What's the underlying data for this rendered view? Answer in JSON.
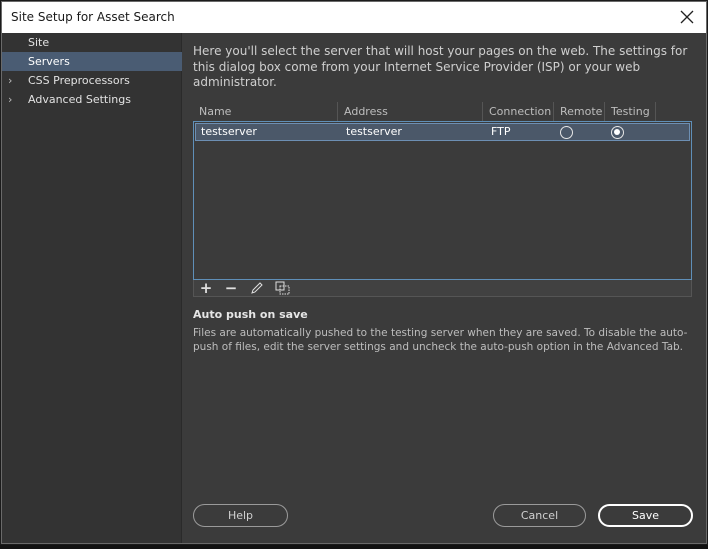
{
  "window": {
    "title": "Site Setup for Asset Search"
  },
  "sidebar": {
    "items": [
      {
        "label": "Site",
        "expandable": false,
        "active": false
      },
      {
        "label": "Servers",
        "expandable": false,
        "active": true
      },
      {
        "label": "CSS Preprocessors",
        "expandable": true,
        "active": false
      },
      {
        "label": "Advanced Settings",
        "expandable": true,
        "active": false
      }
    ]
  },
  "main": {
    "intro": "Here you'll select the server that will host your pages on the web. The settings for this dialog box come from your Internet Service Provider (ISP) or your web administrator.",
    "table": {
      "columns": [
        "Name",
        "Address",
        "Connection",
        "Remote",
        "Testing"
      ],
      "rows": [
        {
          "name": "testserver",
          "address": "testserver",
          "connection": "FTP",
          "remote": false,
          "testing": true
        }
      ]
    },
    "toolbar": {
      "add": "+",
      "remove": "−"
    },
    "auto_push": {
      "title": "Auto push on save",
      "description": "Files are automatically pushed to the testing server when they are saved. To disable the auto-push of files, edit the server settings and uncheck the auto-push option in the Advanced Tab."
    }
  },
  "buttons": {
    "help": "Help",
    "cancel": "Cancel",
    "save": "Save"
  },
  "colors": {
    "selection": "#4a5c73",
    "row_highlight": "#4b5869",
    "dialog_bg": "#3b3b3b"
  }
}
